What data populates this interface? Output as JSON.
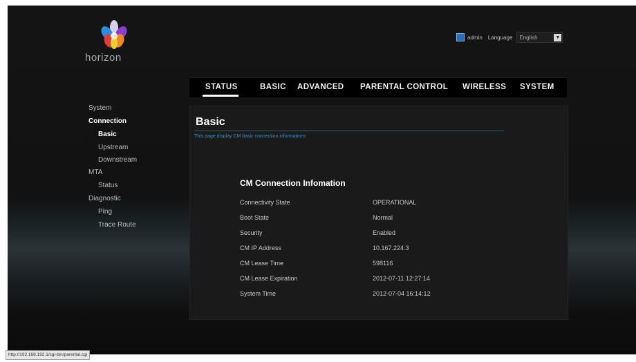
{
  "logo": {
    "text": "horizon"
  },
  "header": {
    "user": "admin",
    "language_label": "Language",
    "language_value": "English"
  },
  "nav": {
    "tabs": [
      {
        "label": "STATUS",
        "active": true
      },
      {
        "label": "BASIC"
      },
      {
        "label": "ADVANCED"
      },
      {
        "label": "PARENTAL CONTROL"
      },
      {
        "label": "WIRELESS"
      },
      {
        "label": "SYSTEM"
      }
    ]
  },
  "sidebar": {
    "items": [
      {
        "label": "System"
      },
      {
        "label": "Connection"
      },
      {
        "label": "Basic"
      },
      {
        "label": "Upstream"
      },
      {
        "label": "Downstream"
      },
      {
        "label": "MTA"
      },
      {
        "label": "Status"
      },
      {
        "label": "Diagnostic"
      },
      {
        "label": "Ping"
      },
      {
        "label": "Trace Route"
      }
    ]
  },
  "page": {
    "title": "Basic",
    "description": "This page display CM basic connection informations",
    "section_title": "CM Connection Infomation",
    "rows": [
      {
        "key": "Connectivity State",
        "value": "OPERATIONAL"
      },
      {
        "key": "Boot State",
        "value": "Normal"
      },
      {
        "key": "Security",
        "value": "Enabled"
      },
      {
        "key": "CM IP Address",
        "value": "10.167.224.3"
      },
      {
        "key": "CM Lease Time",
        "value": "598116"
      },
      {
        "key": "CM Lease Expiration",
        "value": "2012-07-11 12:27:14"
      },
      {
        "key": "System Time",
        "value": "2012-07-04 16:14:12"
      }
    ]
  },
  "statusbar": {
    "url": "http://192.168.192.1/cgi-bin/parental.cgi"
  },
  "colors": {
    "accent": "#3d8fc4",
    "nav_bg": "#000000",
    "panel_bg": "#1a1a1a"
  }
}
